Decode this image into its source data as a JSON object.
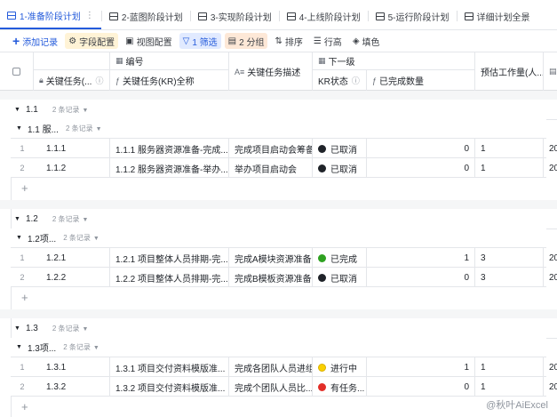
{
  "tabs": [
    {
      "label": "1-准备阶段计划",
      "active": true
    },
    {
      "label": "2-蓝图阶段计划",
      "active": false
    },
    {
      "label": "3-实现阶段计划",
      "active": false
    },
    {
      "label": "4-上线阶段计划",
      "active": false
    },
    {
      "label": "5-运行阶段计划",
      "active": false
    },
    {
      "label": "详细计划全景",
      "active": false
    }
  ],
  "toolbar": {
    "add_record": "添加记录",
    "field_config": "字段配置",
    "view_config": "视图配置",
    "filter": "1 筛选",
    "group": "2 分组",
    "sort": "排序",
    "row_height": "行高",
    "fill_color": "填色"
  },
  "columns": {
    "group_label": "编号",
    "next_level_label": "下一级",
    "key_task_short": "关键任务(...",
    "key_task_full": "关键任务(KR)全称",
    "key_task_desc": "关键任务描述",
    "kr_status": "KR状态",
    "completed_count": "已完成数量",
    "estimated_workload": "预估工作量(人..."
  },
  "sections": [
    {
      "label": "1.1",
      "count": "2 条记录",
      "sub_label": "1.1 服...",
      "sub_count": "2 条记录",
      "rows": [
        {
          "idx": "1",
          "code": "1.1.1",
          "full": "1.1.1 服务器资源准备-完成...",
          "desc": "完成项目启动会筹备",
          "status": "已取消",
          "status_color": "#1f2329",
          "done": "0",
          "est": "1",
          "extra": "20"
        },
        {
          "idx": "2",
          "code": "1.1.2",
          "full": "1.1.2 服务器资源准备-举办...",
          "desc": "举办项目启动会",
          "status": "已取消",
          "status_color": "#1f2329",
          "done": "0",
          "est": "1",
          "extra": "20"
        }
      ]
    },
    {
      "label": "1.2",
      "count": "2 条记录",
      "sub_label": "1.2项...",
      "sub_count": "2 条记录",
      "rows": [
        {
          "idx": "1",
          "code": "1.2.1",
          "full": "1.2.1 项目整体人员排期-完...",
          "desc": "完成A模块资源准备",
          "status": "已完成",
          "status_color": "#2ea121",
          "done": "1",
          "est": "3",
          "extra": "20"
        },
        {
          "idx": "2",
          "code": "1.2.2",
          "full": "1.2.2 项目整体人员排期-完...",
          "desc": "完成B模板资源准备",
          "status": "已取消",
          "status_color": "#1f2329",
          "done": "0",
          "est": "3",
          "extra": "20"
        }
      ]
    },
    {
      "label": "1.3",
      "count": "2 条记录",
      "sub_label": "1.3项...",
      "sub_count": "2 条记录",
      "rows": [
        {
          "idx": "1",
          "code": "1.3.1",
          "full": "1.3.1 项目交付资料模版准...",
          "desc": "完成各团队人员进组",
          "status": "进行中",
          "status_color": "#fad000",
          "done": "1",
          "est": "1",
          "extra": "20"
        },
        {
          "idx": "2",
          "code": "1.3.2",
          "full": "1.3.2 项目交付资料模版准...",
          "desc": "完成个团队人员比...",
          "status": "有任务...",
          "status_color": "#e22e28",
          "done": "0",
          "est": "1",
          "extra": "20"
        }
      ]
    }
  ],
  "add_symbol": "+",
  "watermark": "@秋叶AiExcel"
}
